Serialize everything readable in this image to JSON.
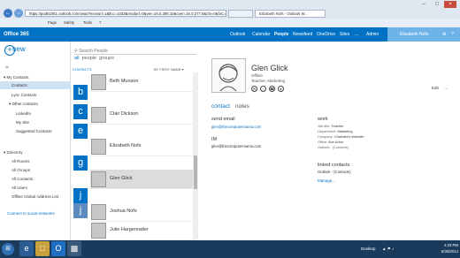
{
  "browser": {
    "url": "https://pod51061.outlook.com/owa/?exsvurl=1&llcc=1033&modurl=0&ver=16.0.288.10&cver=16.0.277.8&cfv=0&fvC=1#path=/people",
    "tab_title": "Elizabeth Nofs - Outlook W...",
    "menu": [
      "Page",
      "Safety",
      "Tools"
    ]
  },
  "o365": {
    "brand": "Office 365",
    "nav": [
      "Outlook",
      "Calendar",
      "People",
      "Newsfeed",
      "OneDrive",
      "Sites",
      "...",
      "Admin"
    ],
    "user": "Elizabeth Nofs"
  },
  "left": {
    "new_label": "new",
    "my_contacts": "My Contacts",
    "contacts": "Contacts",
    "lync": "Lync Contacts",
    "other": "Other contacts",
    "linkedin": "LinkedIn",
    "mysite": "My Site",
    "suggested": "Suggested Contacts",
    "directory": "Directory",
    "dir_items": [
      "All Rooms",
      "All Groups",
      "All Contacts",
      "All Users",
      "Offline Global Address List"
    ],
    "connect": "Connect to social networks"
  },
  "middle": {
    "search_placeholder": "Search People",
    "filters": [
      "all",
      "people",
      "groups"
    ],
    "list_label": "CONTACTS",
    "sort_label": "BY FIRST NAME",
    "letters": [
      "b",
      "c",
      "e",
      "g",
      "j",
      "j"
    ],
    "contacts": [
      "Beth Munson",
      "Clair Dickson",
      "Elizabeth Nofs",
      "Glen Glick",
      "Joshua Nofs",
      "Julie Hargenrader"
    ]
  },
  "detail": {
    "name": "Glen Glick",
    "office": "Offline",
    "title": "Teacher, Marketing",
    "tabs": [
      "contact",
      "notes"
    ],
    "edit": "Edit",
    "send_email_label": "send email",
    "email": "glen@thecomputermama.com",
    "im_label": "IM",
    "im": "glen@thecomputermama.com",
    "work_label": "work",
    "work_fields": [
      {
        "label": "Job title:",
        "value": "Teacher"
      },
      {
        "label": "Department:",
        "value": "Marketing"
      },
      {
        "label": "Company:",
        "value": "Charlotte's Website"
      },
      {
        "label": "Office:",
        "value": "Ann Arbor"
      },
      {
        "label": "Outlook - (Contacts)",
        "value": ""
      }
    ],
    "linked_label": "linked contacts",
    "linked_value": "Outlook - (Contacts)",
    "manage": "Manage..."
  },
  "taskbar": {
    "desktop": "Desktop",
    "time": "4:23 PM",
    "date": "6/30/2014"
  }
}
